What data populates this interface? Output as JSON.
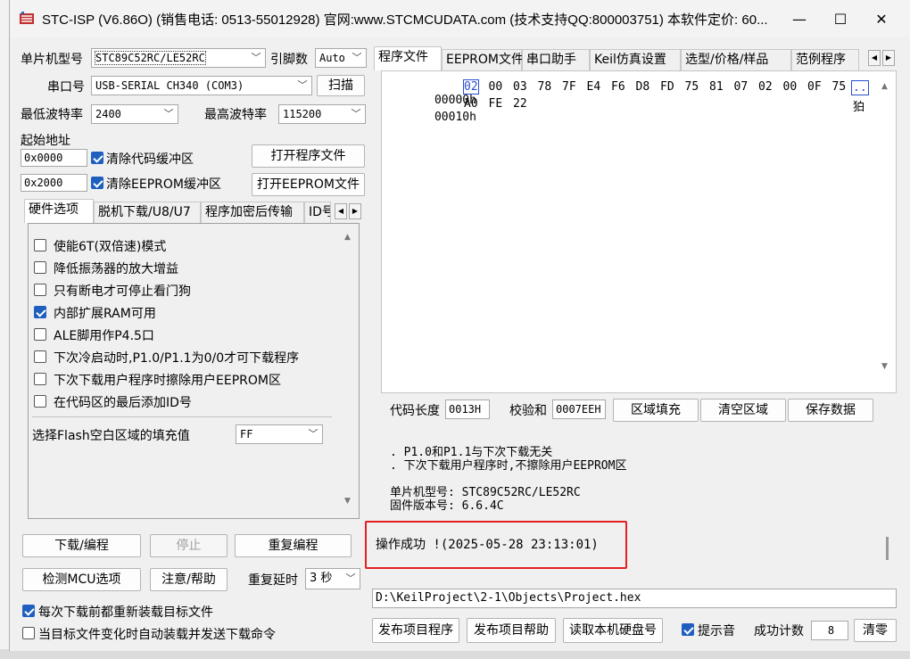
{
  "window": {
    "title": "STC-ISP (V6.86O) (销售电话: 0513-55012928) 官网:www.STCMCUDATA.com  (技术支持QQ:800003751) 本软件定价: 60...",
    "min_symbol": "—",
    "max_symbol": "☐",
    "close_symbol": "✕"
  },
  "left": {
    "mcu_label": "单片机型号",
    "mcu_value": "STC89C52RC/LE52RC",
    "pin_label": "引脚数",
    "pin_value": "Auto",
    "port_label": "串口号",
    "port_value": "USB-SERIAL CH340 (COM3)",
    "scan_button": "扫描",
    "min_baud_label": "最低波特率",
    "min_baud_value": "2400",
    "max_baud_label": "最高波特率",
    "max_baud_value": "115200",
    "start_addr_label": "起始地址",
    "addr1_value": "0x0000",
    "clear_code_label": "清除代码缓冲区",
    "open_program_button": "打开程序文件",
    "addr2_value": "0x2000",
    "clear_eeprom_label": "清除EEPROM缓冲区",
    "open_eeprom_button": "打开EEPROM文件",
    "tabs": [
      "硬件选项",
      "脱机下载/U8/U7",
      "程序加密后传输",
      "ID号"
    ],
    "options": [
      {
        "label": "使能6T(双倍速)模式",
        "checked": false
      },
      {
        "label": "降低振荡器的放大增益",
        "checked": false
      },
      {
        "label": "只有断电才可停止看门狗",
        "checked": false
      },
      {
        "label": "内部扩展RAM可用",
        "checked": true
      },
      {
        "label": "ALE脚用作P4.5口",
        "checked": false
      },
      {
        "label": "下次冷启动时,P1.0/P1.1为0/0才可下载程序",
        "checked": false
      },
      {
        "label": "下次下载用户程序时擦除用户EEPROM区",
        "checked": false
      },
      {
        "label": "在代码区的最后添加ID号",
        "checked": false
      }
    ],
    "fill_label": "选择Flash空白区域的填充值",
    "fill_value": "FF",
    "download_button": "下载/编程",
    "stop_button": "停止",
    "reprogram_button": "重复编程",
    "check_mcu_button": "检测MCU选项",
    "help_button": "注意/帮助",
    "repeat_delay_label": "重复延时",
    "repeat_delay_value": "3 秒",
    "reload_label": "每次下载前都重新装载目标文件",
    "auto_load_label": "当目标文件变化时自动装载并发送下载命令"
  },
  "right": {
    "tabs": [
      "程序文件",
      "EEPROM文件",
      "串口助手",
      "Keil仿真设置",
      "选型/价格/样品",
      "范例程序"
    ],
    "hex_rows": [
      {
        "addr": "00000h",
        "bytes": [
          "02",
          "00",
          "03",
          "78",
          "7F",
          "E4",
          "F6",
          "D8",
          "FD",
          "75",
          "81",
          "07",
          "02",
          "00",
          "0F",
          "75"
        ],
        "ascii": "..",
        "selected": 0
      },
      {
        "addr": "00010h",
        "bytes": [
          "A0",
          "FE",
          "22"
        ],
        "ascii": "狛"
      }
    ],
    "code_len_label": "代码长度",
    "code_len_value": "0013H",
    "checksum_label": "校验和",
    "checksum_value": "0007EEH",
    "fill_area_button": "区域填充",
    "clear_area_button": "清空区域",
    "save_data_button": "保存数据",
    "log_lines": [
      ". P1.0和P1.1与下次下载无关",
      ". 下次下载用户程序时,不擦除用户EEPROM区",
      "",
      "单片机型号: STC89C52RC/LE52RC",
      "固件版本号: 6.6.4C"
    ],
    "success_message": "操作成功 !(2025-05-28 23:13:01)",
    "file_path": "D:\\KeilProject\\2-1\\Objects\\Project.hex",
    "publish_button": "发布项目程序",
    "publish_help_button": "发布项目帮助",
    "read_disk_button": "读取本机硬盘号",
    "beep_label": "提示音",
    "success_count_label": "成功计数",
    "success_count_value": "8",
    "reset_button": "清零"
  },
  "colors": {
    "accent": "#1f5fbf",
    "highlight_box": "#e52020",
    "selection": "#2a4fd0"
  }
}
